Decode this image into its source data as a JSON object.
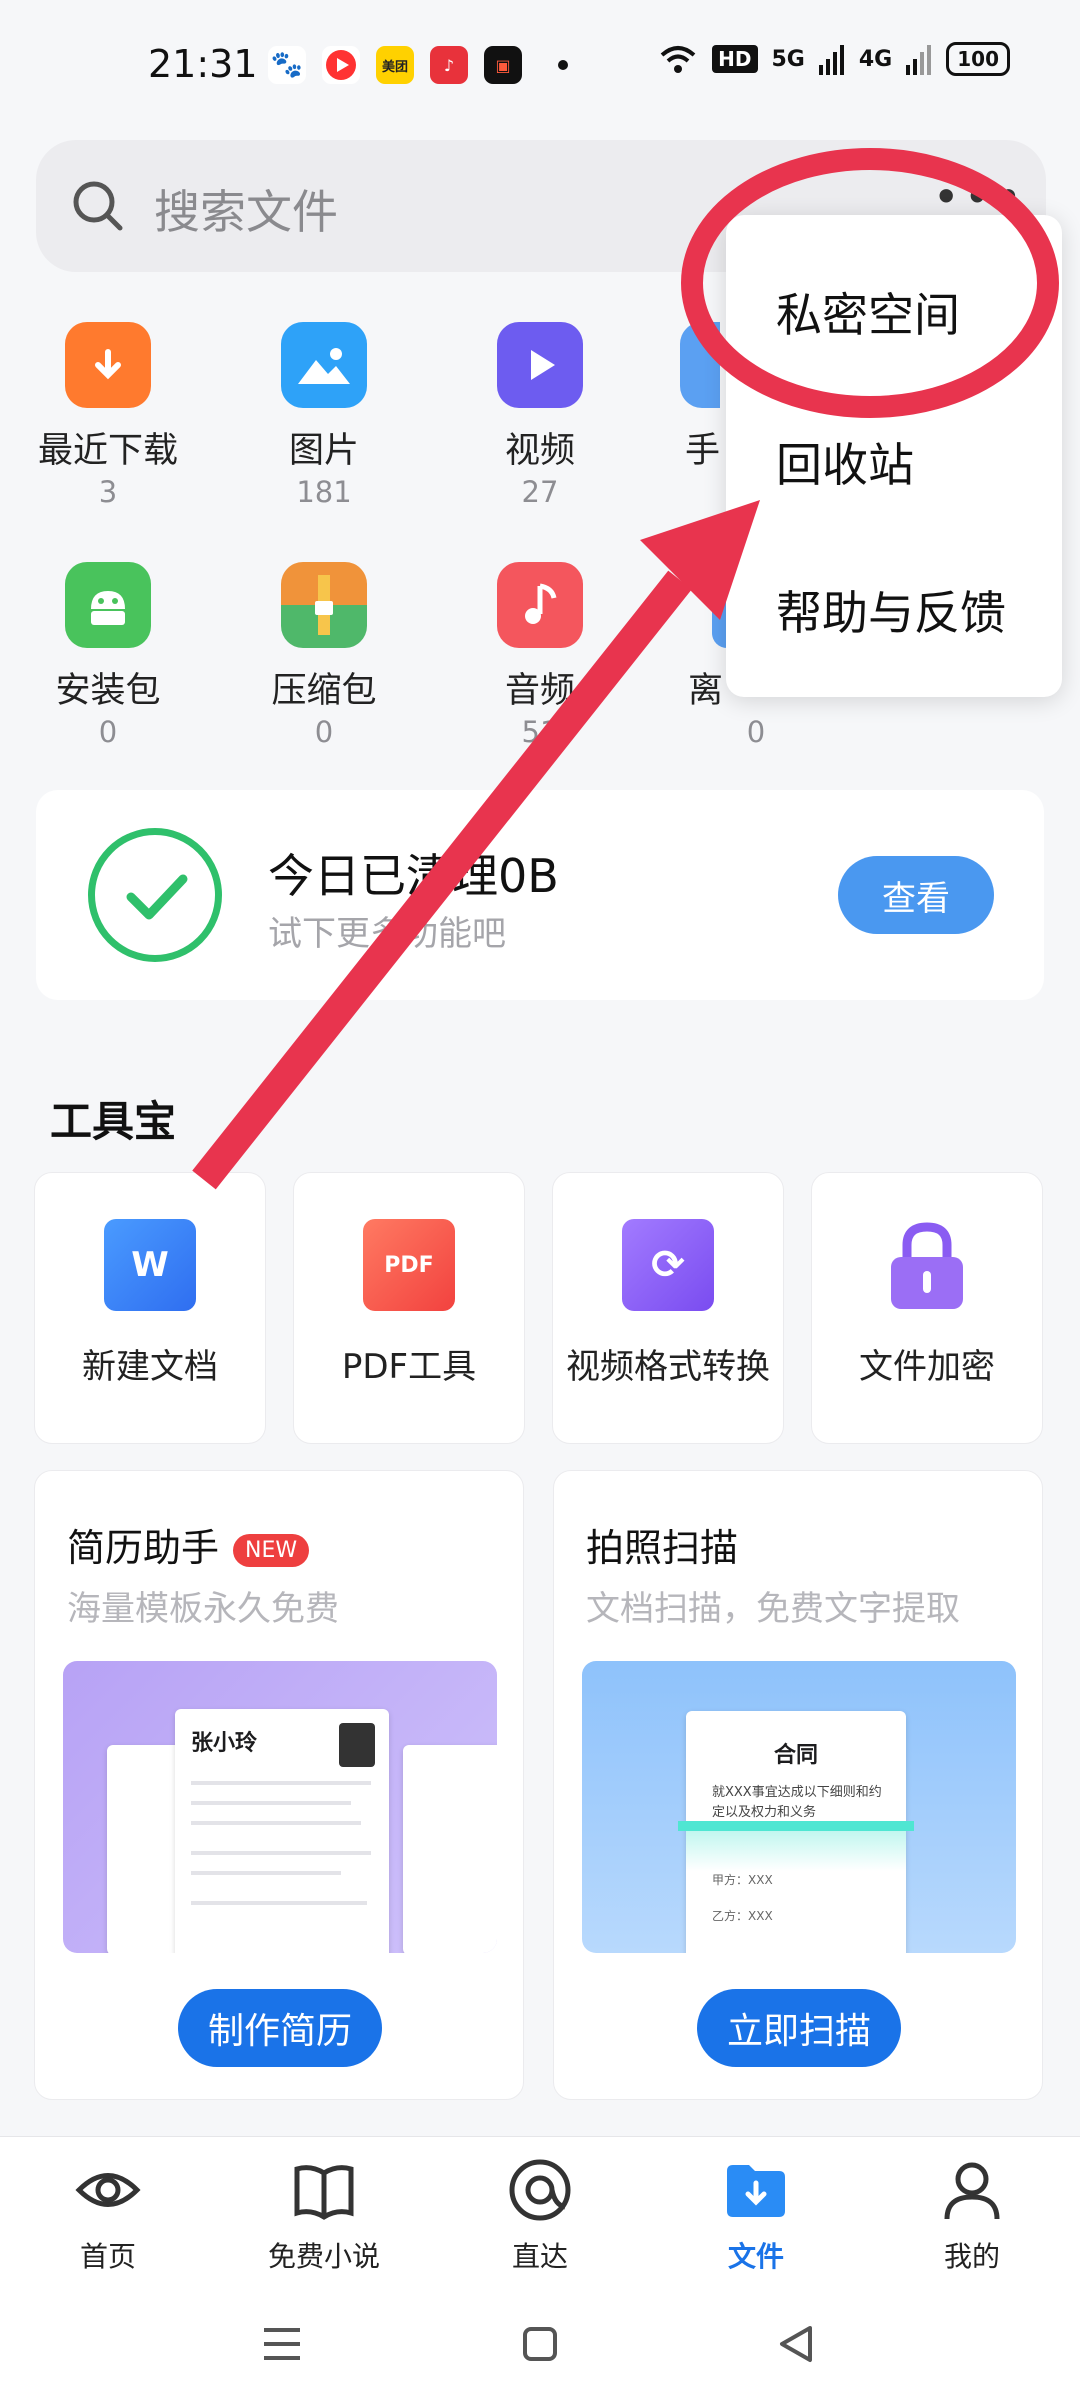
{
  "status": {
    "time": "21:31",
    "battery": "100",
    "network": [
      "HD",
      "5G",
      "4G"
    ]
  },
  "search": {
    "placeholder": "搜索文件"
  },
  "categories": [
    {
      "label": "最近下载",
      "count": "3",
      "color": "#ff7a2e"
    },
    {
      "label": "图片",
      "count": "181",
      "color": "#2ea2f8"
    },
    {
      "label": "视频",
      "count": "27",
      "color": "#6d5cf0"
    },
    {
      "label": "手",
      "count": "",
      "color": "#5ba0f2"
    },
    {
      "label": "安装包",
      "count": "0",
      "color": "#49c35c"
    },
    {
      "label": "压缩包",
      "count": "0",
      "color": "#f0933a"
    },
    {
      "label": "音频",
      "count": "51",
      "color": "#f4565d"
    },
    {
      "label": "离",
      "count": "0",
      "color": "#5ba0f2"
    }
  ],
  "menu": {
    "items": [
      "私密空间",
      "回收站",
      "帮助与反馈"
    ]
  },
  "clean_card": {
    "title": "今日已清理0B",
    "subtitle": "试下更多功能吧",
    "button": "查看"
  },
  "toolbox": {
    "title": "工具宝",
    "tools": [
      {
        "label": "新建文档",
        "icon_text": "W",
        "color": "#2f7ef6"
      },
      {
        "label": "PDF工具",
        "icon_text": "PDF",
        "color": "#f2564e"
      },
      {
        "label": "视频格式转换",
        "icon_text": "⟳",
        "color": "#8a5cf2"
      },
      {
        "label": "文件加密",
        "icon_text": "",
        "color": "#8a5cf2"
      }
    ]
  },
  "promos": [
    {
      "title": "简历助手",
      "badge": "NEW",
      "subtitle": "海量模板永久免费",
      "button": "制作简历",
      "image_text": "张小玲"
    },
    {
      "title": "拍照扫描",
      "badge": "",
      "subtitle": "文档扫描，免费文字提取",
      "button": "立即扫描",
      "image_text": "合同",
      "image_body": "就XXX事宜达成以下细则和约定以及权力和义务",
      "party_a": "甲方：XXX",
      "party_b": "乙方：XXX"
    }
  ],
  "nav": {
    "items": [
      "首页",
      "免费小说",
      "直达",
      "文件",
      "我的"
    ],
    "active": "文件"
  },
  "colors": {
    "accent": "#1a73e8",
    "annotation": "#e8344e",
    "check": "#2fc06b"
  }
}
